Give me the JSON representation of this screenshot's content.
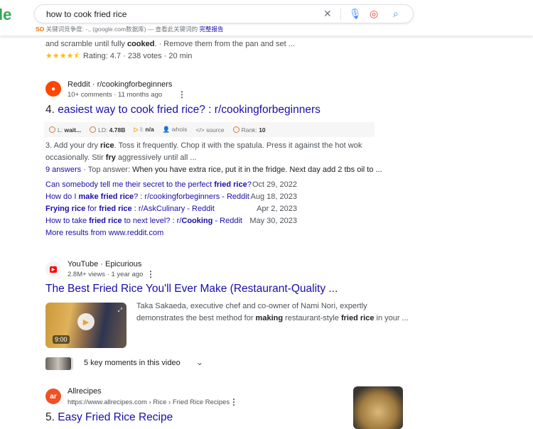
{
  "header": {
    "logo_partial": "le",
    "query": "how to cook fried rice",
    "kw_icon_text": "SO",
    "kw_text": "关键词竞争度: -., (google.com数据库) — 查看此关键词的",
    "kw_link": "完整报告"
  },
  "colors": {
    "link": "#1a0dab",
    "star": "#fbbc04",
    "reddit": "#ff4500",
    "youtube": "#ff0000",
    "allrecipes": "#f15025"
  },
  "prev": {
    "snippet": [
      {
        "t": "and scramble until fully "
      },
      {
        "t": "cooked",
        "b": true
      },
      {
        "t": ". · Remove them from the pan and set ..."
      }
    ],
    "stars": "★★★★⯪",
    "rating": "Rating: 4.7 · 238 votes · 20 min"
  },
  "reddit": {
    "site": "Reddit · r/cookingforbeginners",
    "meta": "10+ comments · 11 months ago",
    "num": "4.",
    "title": "easiest way to cook fried rice? : r/cookingforbeginners",
    "toolbar": {
      "l_label": "L:",
      "l_val": "wait...",
      "ld_label": "LD:",
      "ld_val": "4.78B",
      "i_label": "I:",
      "i_val": "n/a",
      "whois": "whois",
      "source": "source",
      "rank_label": "Rank:",
      "rank_val": "10"
    },
    "snippet1": [
      {
        "t": "3. Add your dry "
      },
      {
        "t": "rice",
        "b": true
      },
      {
        "t": ". Toss it frequently. Chop it with the spatula. Press it against the hot wok"
      }
    ],
    "snippet2": [
      {
        "t": "occasionally. Stir "
      },
      {
        "t": "fry",
        "b": true
      },
      {
        "t": " aggressively until all ..."
      }
    ],
    "answers": "9 answers",
    "top_answer_label": " · Top answer: ",
    "top_answer": "When you have extra rice, put it in the fridge. Next day add 2 tbs oil to ...",
    "links": [
      {
        "parts": [
          {
            "t": "Can somebody tell me their secret to the perfect "
          },
          {
            "t": "fried rice",
            "b": true
          },
          {
            "t": "?"
          }
        ],
        "date": "Oct 29, 2022"
      },
      {
        "parts": [
          {
            "t": "How do I "
          },
          {
            "t": "make fried rice",
            "b": true
          },
          {
            "t": "? : r/cookingforbeginners - Reddit"
          }
        ],
        "date": "Aug 18, 2023"
      },
      {
        "parts": [
          {
            "t": "Frying rice",
            "b": true
          },
          {
            "t": " for "
          },
          {
            "t": "fried rice",
            "b": true
          },
          {
            "t": " : r/AskCulinary - Reddit"
          }
        ],
        "date": "Apr 2, 2023"
      },
      {
        "parts": [
          {
            "t": "How to take "
          },
          {
            "t": "fried rice",
            "b": true
          },
          {
            "t": " to next level? : r/"
          },
          {
            "t": "Cooking",
            "b": true
          },
          {
            "t": " - Reddit"
          }
        ],
        "date": "May 30, 2023"
      }
    ],
    "more": "More results from www.reddit.com"
  },
  "youtube": {
    "site": "YouTube · Epicurious",
    "meta": "2.8M+ views · 1 year ago",
    "title": "The Best Fried Rice You'll Ever Make (Restaurant-Quality ...",
    "duration": "9:00",
    "desc1": [
      {
        "t": "Taka Sakaeda, executive chef and co-owner of Nami Nori, expertly"
      }
    ],
    "desc2": [
      {
        "t": "demonstrates the best method for "
      },
      {
        "t": "making",
        "b": true
      },
      {
        "t": " restaurant-style "
      },
      {
        "t": "fried rice",
        "b": true
      },
      {
        "t": " in your ..."
      }
    ],
    "key_moments": "5 key moments in this video"
  },
  "allrecipes": {
    "site": "Allrecipes",
    "fav": "ar",
    "url": "https://www.allrecipes.com › Rice › Fried Rice Recipes",
    "num": "5.",
    "title": "Easy Fried Rice Recipe"
  }
}
